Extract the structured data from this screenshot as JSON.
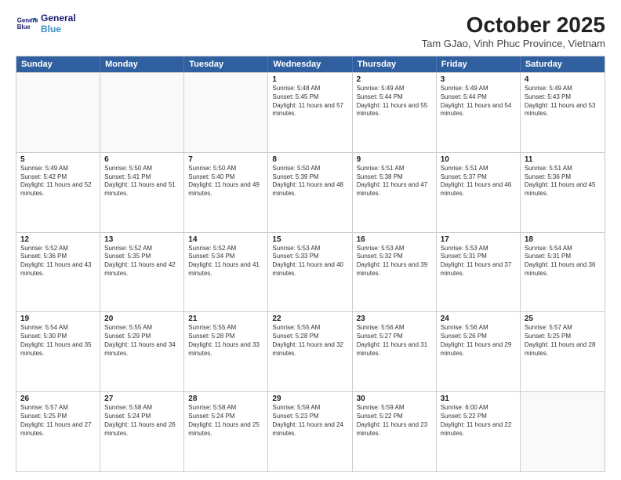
{
  "header": {
    "logo_line1": "General",
    "logo_line2": "Blue",
    "month_title": "October 2025",
    "subtitle": "Tam GJao, Vinh Phuc Province, Vietnam"
  },
  "weekdays": [
    "Sunday",
    "Monday",
    "Tuesday",
    "Wednesday",
    "Thursday",
    "Friday",
    "Saturday"
  ],
  "rows": [
    [
      {
        "day": "",
        "info": ""
      },
      {
        "day": "",
        "info": ""
      },
      {
        "day": "",
        "info": ""
      },
      {
        "day": "1",
        "info": "Sunrise: 5:48 AM\nSunset: 5:45 PM\nDaylight: 11 hours and 57 minutes."
      },
      {
        "day": "2",
        "info": "Sunrise: 5:49 AM\nSunset: 5:44 PM\nDaylight: 11 hours and 55 minutes."
      },
      {
        "day": "3",
        "info": "Sunrise: 5:49 AM\nSunset: 5:44 PM\nDaylight: 11 hours and 54 minutes."
      },
      {
        "day": "4",
        "info": "Sunrise: 5:49 AM\nSunset: 5:43 PM\nDaylight: 11 hours and 53 minutes."
      }
    ],
    [
      {
        "day": "5",
        "info": "Sunrise: 5:49 AM\nSunset: 5:42 PM\nDaylight: 11 hours and 52 minutes."
      },
      {
        "day": "6",
        "info": "Sunrise: 5:50 AM\nSunset: 5:41 PM\nDaylight: 11 hours and 51 minutes."
      },
      {
        "day": "7",
        "info": "Sunrise: 5:50 AM\nSunset: 5:40 PM\nDaylight: 11 hours and 49 minutes."
      },
      {
        "day": "8",
        "info": "Sunrise: 5:50 AM\nSunset: 5:39 PM\nDaylight: 11 hours and 48 minutes."
      },
      {
        "day": "9",
        "info": "Sunrise: 5:51 AM\nSunset: 5:38 PM\nDaylight: 11 hours and 47 minutes."
      },
      {
        "day": "10",
        "info": "Sunrise: 5:51 AM\nSunset: 5:37 PM\nDaylight: 11 hours and 46 minutes."
      },
      {
        "day": "11",
        "info": "Sunrise: 5:51 AM\nSunset: 5:36 PM\nDaylight: 11 hours and 45 minutes."
      }
    ],
    [
      {
        "day": "12",
        "info": "Sunrise: 5:52 AM\nSunset: 5:36 PM\nDaylight: 11 hours and 43 minutes."
      },
      {
        "day": "13",
        "info": "Sunrise: 5:52 AM\nSunset: 5:35 PM\nDaylight: 11 hours and 42 minutes."
      },
      {
        "day": "14",
        "info": "Sunrise: 5:52 AM\nSunset: 5:34 PM\nDaylight: 11 hours and 41 minutes."
      },
      {
        "day": "15",
        "info": "Sunrise: 5:53 AM\nSunset: 5:33 PM\nDaylight: 11 hours and 40 minutes."
      },
      {
        "day": "16",
        "info": "Sunrise: 5:53 AM\nSunset: 5:32 PM\nDaylight: 11 hours and 39 minutes."
      },
      {
        "day": "17",
        "info": "Sunrise: 5:53 AM\nSunset: 5:31 PM\nDaylight: 11 hours and 37 minutes."
      },
      {
        "day": "18",
        "info": "Sunrise: 5:54 AM\nSunset: 5:31 PM\nDaylight: 11 hours and 36 minutes."
      }
    ],
    [
      {
        "day": "19",
        "info": "Sunrise: 5:54 AM\nSunset: 5:30 PM\nDaylight: 11 hours and 35 minutes."
      },
      {
        "day": "20",
        "info": "Sunrise: 5:55 AM\nSunset: 5:29 PM\nDaylight: 11 hours and 34 minutes."
      },
      {
        "day": "21",
        "info": "Sunrise: 5:55 AM\nSunset: 5:28 PM\nDaylight: 11 hours and 33 minutes."
      },
      {
        "day": "22",
        "info": "Sunrise: 5:55 AM\nSunset: 5:28 PM\nDaylight: 11 hours and 32 minutes."
      },
      {
        "day": "23",
        "info": "Sunrise: 5:56 AM\nSunset: 5:27 PM\nDaylight: 11 hours and 31 minutes."
      },
      {
        "day": "24",
        "info": "Sunrise: 5:56 AM\nSunset: 5:26 PM\nDaylight: 11 hours and 29 minutes."
      },
      {
        "day": "25",
        "info": "Sunrise: 5:57 AM\nSunset: 5:25 PM\nDaylight: 11 hours and 28 minutes."
      }
    ],
    [
      {
        "day": "26",
        "info": "Sunrise: 5:57 AM\nSunset: 5:25 PM\nDaylight: 11 hours and 27 minutes."
      },
      {
        "day": "27",
        "info": "Sunrise: 5:58 AM\nSunset: 5:24 PM\nDaylight: 11 hours and 26 minutes."
      },
      {
        "day": "28",
        "info": "Sunrise: 5:58 AM\nSunset: 5:24 PM\nDaylight: 11 hours and 25 minutes."
      },
      {
        "day": "29",
        "info": "Sunrise: 5:59 AM\nSunset: 5:23 PM\nDaylight: 11 hours and 24 minutes."
      },
      {
        "day": "30",
        "info": "Sunrise: 5:59 AM\nSunset: 5:22 PM\nDaylight: 11 hours and 23 minutes."
      },
      {
        "day": "31",
        "info": "Sunrise: 6:00 AM\nSunset: 5:22 PM\nDaylight: 11 hours and 22 minutes."
      },
      {
        "day": "",
        "info": ""
      }
    ]
  ]
}
